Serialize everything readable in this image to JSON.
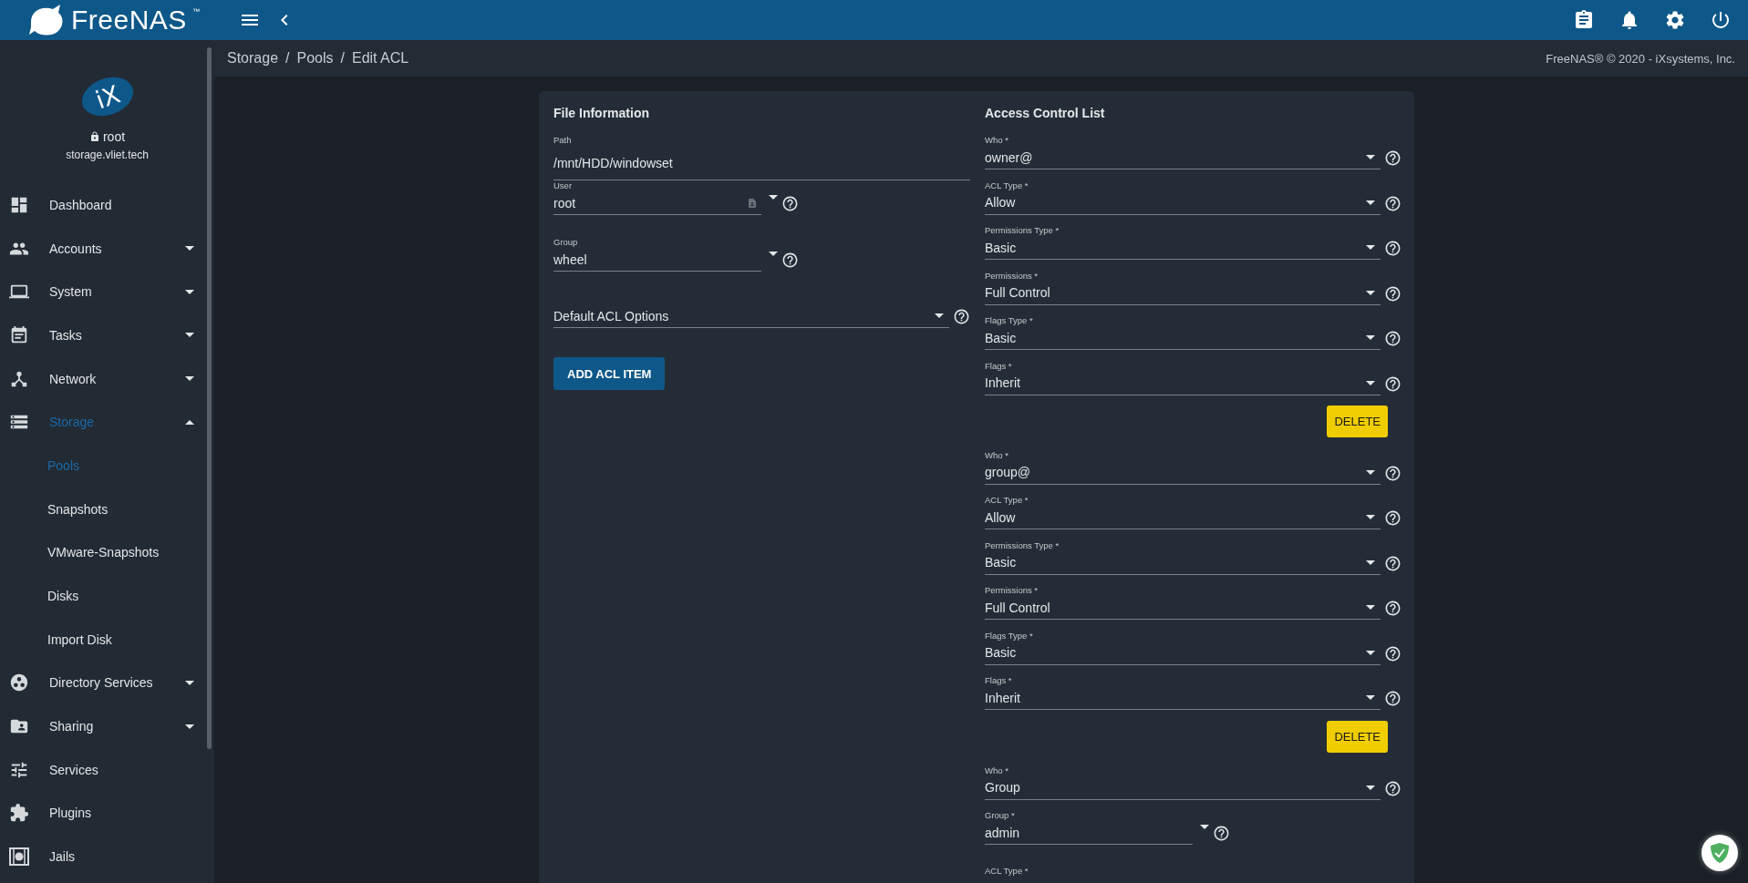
{
  "topbar": {
    "brand": "FreeNAS",
    "trademark": "™"
  },
  "sidebar": {
    "logo_text": "iX",
    "user": "root",
    "host": "storage.vliet.tech",
    "items": [
      {
        "label": "Dashboard",
        "kind": "link",
        "selected": false
      },
      {
        "label": "Accounts",
        "kind": "group",
        "expanded": false,
        "selected": false
      },
      {
        "label": "System",
        "kind": "group",
        "expanded": false,
        "selected": false
      },
      {
        "label": "Tasks",
        "kind": "group",
        "expanded": false,
        "selected": false
      },
      {
        "label": "Network",
        "kind": "group",
        "expanded": false,
        "selected": false
      },
      {
        "label": "Storage",
        "kind": "group",
        "expanded": true,
        "selected": true,
        "children": [
          {
            "label": "Pools",
            "selected": true
          },
          {
            "label": "Snapshots",
            "selected": false
          },
          {
            "label": "VMware-Snapshots",
            "selected": false
          },
          {
            "label": "Disks",
            "selected": false
          },
          {
            "label": "Import Disk",
            "selected": false
          }
        ]
      },
      {
        "label": "Directory Services",
        "kind": "group",
        "expanded": false,
        "selected": false
      },
      {
        "label": "Sharing",
        "kind": "group",
        "expanded": false,
        "selected": false
      },
      {
        "label": "Services",
        "kind": "link",
        "selected": false
      },
      {
        "label": "Plugins",
        "kind": "link",
        "selected": false
      },
      {
        "label": "Jails",
        "kind": "link",
        "selected": false
      }
    ]
  },
  "breadcrumb": [
    "Storage",
    "Pools",
    "Edit ACL"
  ],
  "breadcrumb_separator": "/",
  "copyright": "FreeNAS® © 2020 - iXsystems, Inc.",
  "file_information": {
    "title": "File Information",
    "fields": [
      {
        "kind": "text",
        "label": "Path",
        "value": "/mnt/HDD/windowset"
      },
      {
        "kind": "combo",
        "label": "User",
        "value": "root"
      },
      {
        "kind": "combo",
        "label": "Group",
        "value": "wheel"
      },
      {
        "kind": "select",
        "value": "Default ACL Options"
      }
    ],
    "add_button": "ADD ACL ITEM"
  },
  "access_control_list": {
    "title": "Access Control List",
    "entries": [
      {
        "fields": [
          {
            "kind": "select",
            "label": "Who *",
            "value": "owner@"
          },
          {
            "kind": "select",
            "label": "ACL Type *",
            "value": "Allow"
          },
          {
            "kind": "select",
            "label": "Permissions Type *",
            "value": "Basic"
          },
          {
            "kind": "select",
            "label": "Permissions *",
            "value": "Full Control"
          },
          {
            "kind": "select",
            "label": "Flags Type *",
            "value": "Basic"
          },
          {
            "kind": "select",
            "label": "Flags *",
            "value": "Inherit"
          }
        ],
        "delete_button": "DELETE"
      },
      {
        "fields": [
          {
            "kind": "select",
            "label": "Who *",
            "value": "group@"
          },
          {
            "kind": "select",
            "label": "ACL Type *",
            "value": "Allow"
          },
          {
            "kind": "select",
            "label": "Permissions Type *",
            "value": "Basic"
          },
          {
            "kind": "select",
            "label": "Permissions *",
            "value": "Full Control"
          },
          {
            "kind": "select",
            "label": "Flags Type *",
            "value": "Basic"
          },
          {
            "kind": "select",
            "label": "Flags *",
            "value": "Inherit"
          }
        ],
        "delete_button": "DELETE"
      },
      {
        "fields": [
          {
            "kind": "select",
            "label": "Who *",
            "value": "Group"
          },
          {
            "kind": "combo",
            "label": "Group *",
            "value": "admin"
          },
          {
            "kind": "label",
            "label": "ACL Type *"
          }
        ]
      }
    ]
  }
}
